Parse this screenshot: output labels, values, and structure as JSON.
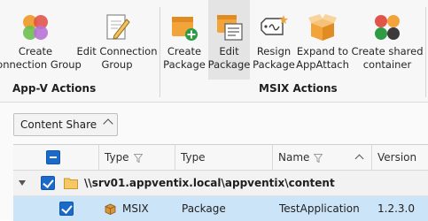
{
  "ribbon": {
    "appv_group": {
      "title": "App-V Actions",
      "buttons": [
        {
          "label_line1": "Create",
          "label_line2": "Connection Group"
        },
        {
          "label_line1": "Edit Connection",
          "label_line2": "Group"
        }
      ]
    },
    "msix_group": {
      "title": "MSIX Actions",
      "buttons": [
        {
          "label_line1": "Create",
          "label_line2": "Package"
        },
        {
          "label_line1": "Edit",
          "label_line2": "Package"
        },
        {
          "label_line1": "Resign",
          "label_line2": "Package"
        },
        {
          "label_line1": "Expand to",
          "label_line2": "AppAttach"
        },
        {
          "label_line1": "Create shared",
          "label_line2": "container"
        }
      ]
    }
  },
  "filter": {
    "selected": "Content Share"
  },
  "grid": {
    "columns": [
      "Type",
      "Type",
      "Name",
      "Version"
    ],
    "group_row": {
      "path": "\\\\srv01.appventix.local\\appventix\\content"
    },
    "rows": [
      {
        "type_icon_label": "MSIX",
        "type": "Package",
        "name": "TestApplication",
        "version": "1.2.3.0"
      }
    ]
  },
  "colors": {
    "accent": "#1b6ac9",
    "selected_row": "#cce4f7"
  }
}
